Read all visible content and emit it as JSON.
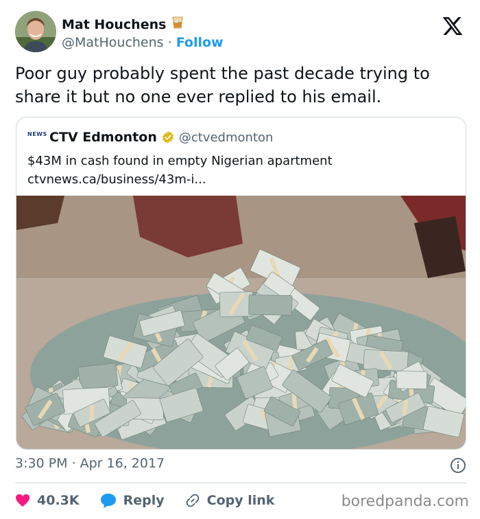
{
  "author": {
    "name": "Mat Houchens",
    "emoji_icon": "whiskey-glass-icon",
    "handle": "@MatHouchens",
    "separator": "·",
    "follow_label": "Follow"
  },
  "tweet": {
    "text": "Poor guy probably spent the past decade trying to share it but no one ever replied to his email."
  },
  "quote": {
    "logo_text": "NEWS",
    "name": "CTV Edmonton",
    "verified_icon": "verified-badge-icon",
    "handle": "@ctvedmonton",
    "headline": "$43M in cash found in empty Nigerian apartment",
    "link": "ctvnews.ca/business/43m-i..."
  },
  "meta": {
    "time": "3:30 PM",
    "separator": "·",
    "date": "Apr 16, 2017"
  },
  "actions": {
    "likes": "40.3K",
    "reply_label": "Reply",
    "copy_link_label": "Copy link"
  },
  "watermark": "boredpanda.com",
  "colors": {
    "accent": "#1d9bf0",
    "like": "#f91880",
    "secondary_text": "#536471",
    "border": "#cfd9de",
    "verified_gold": "#e2b719"
  }
}
